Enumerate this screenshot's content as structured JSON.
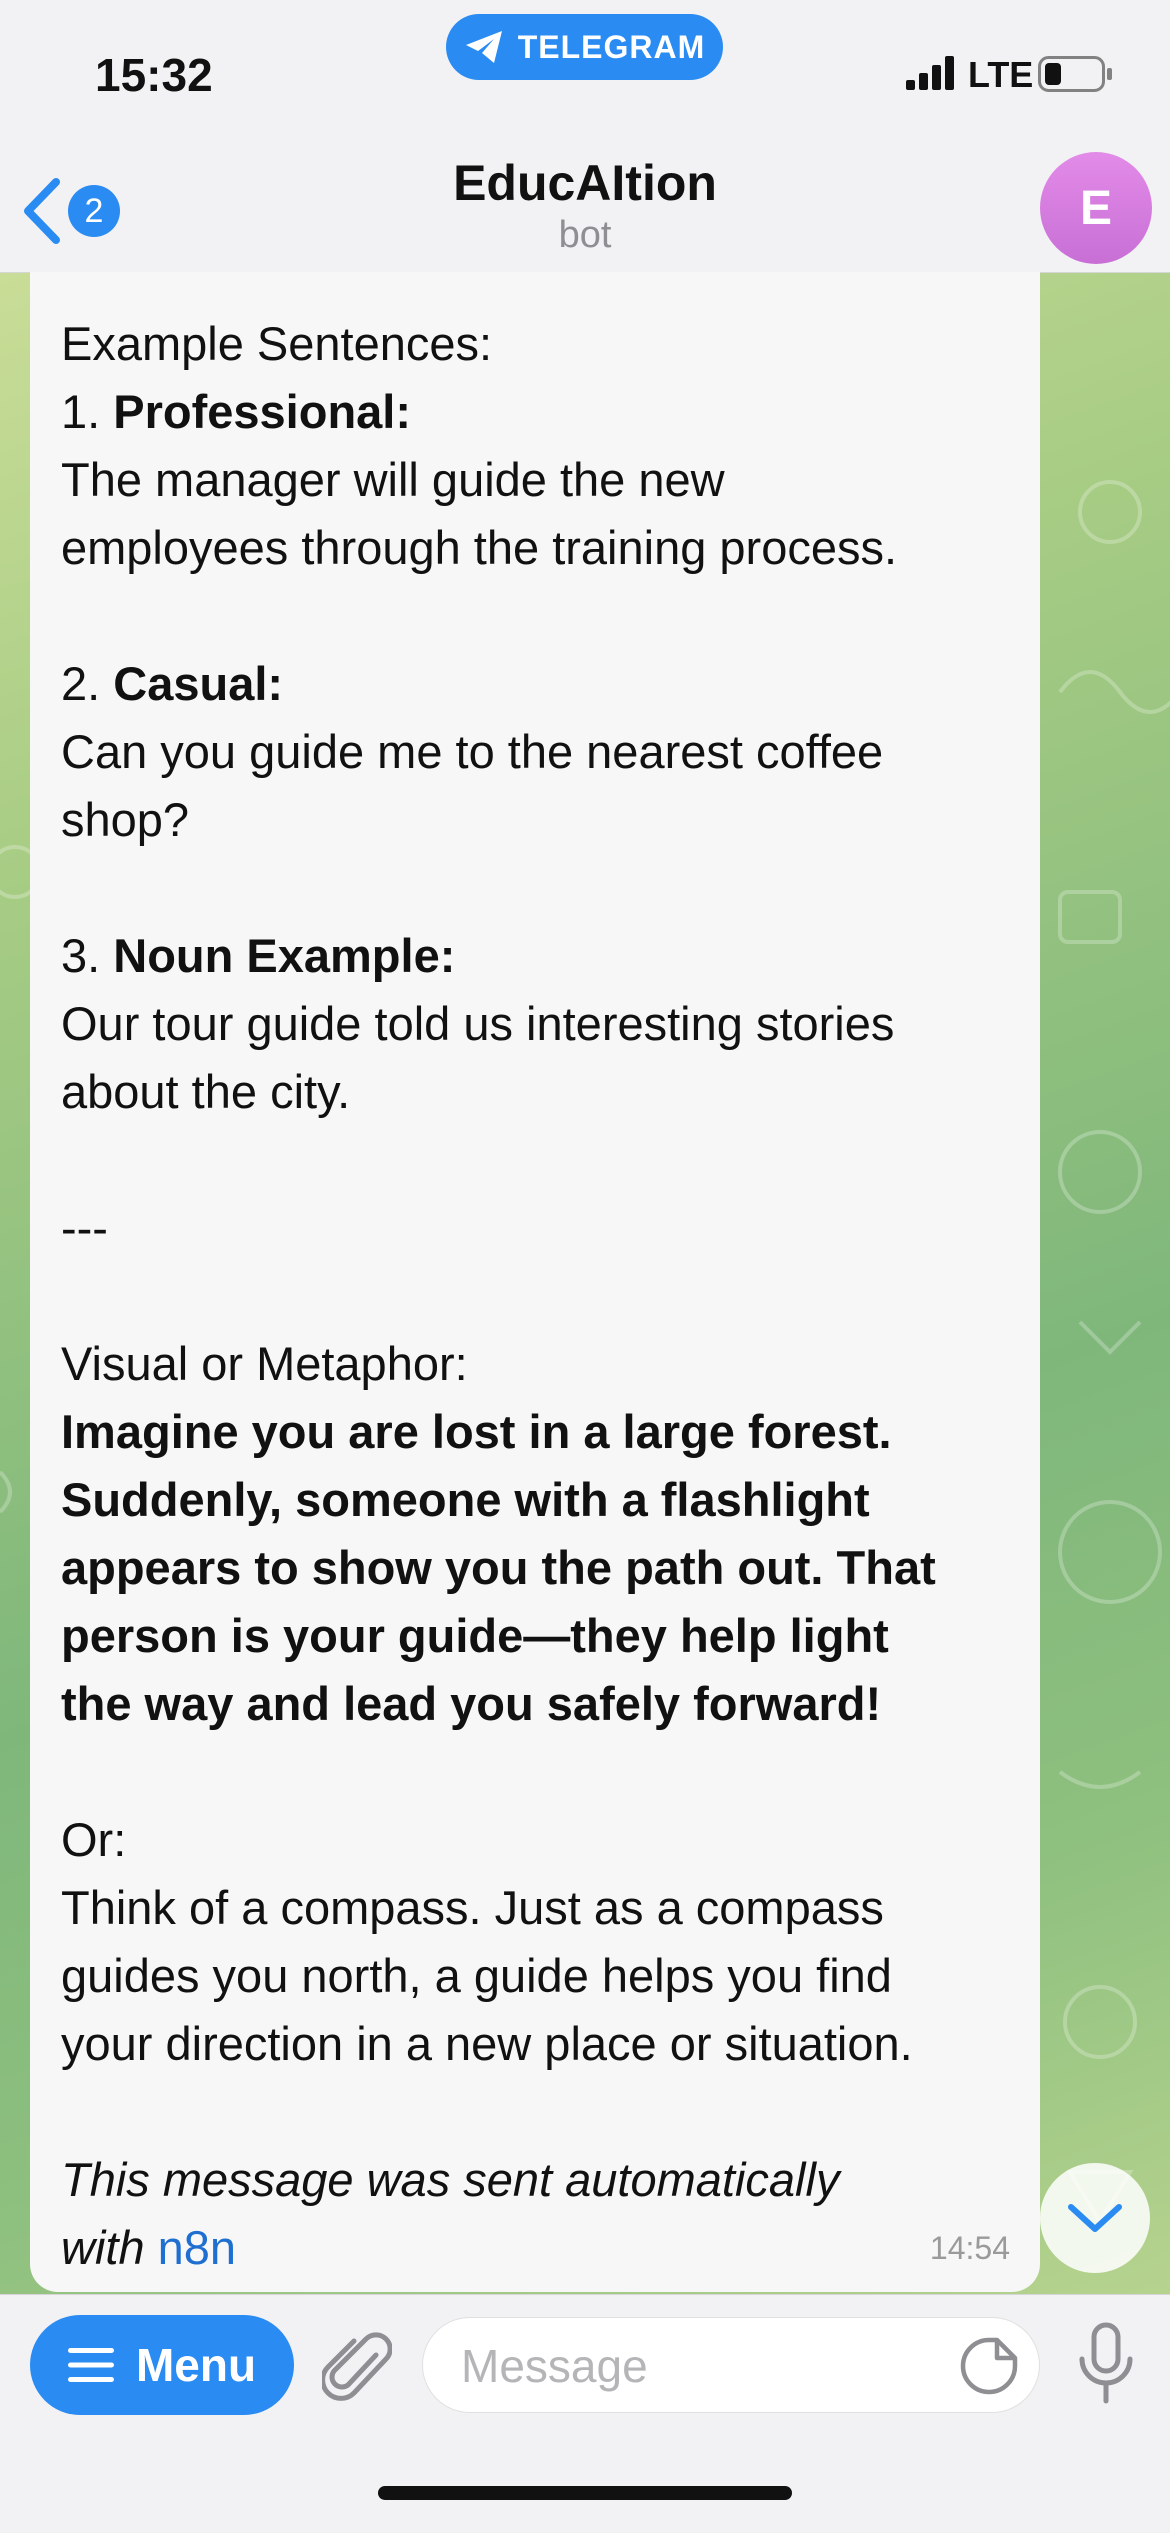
{
  "status_bar": {
    "time": "15:32",
    "carrier_pill": "TELEGRAM",
    "network": "LTE"
  },
  "header": {
    "back_badge": "2",
    "title": "EducAItion",
    "subtitle": "bot",
    "avatar_letter": "E"
  },
  "message": {
    "example_heading": "Example Sentences:",
    "ex1_num": "1. ",
    "ex1_label": "Professional:",
    "ex1_line1": "The manager will guide the new",
    "ex1_line2": "employees through the training process.",
    "ex2_num": "2. ",
    "ex2_label": "Casual:",
    "ex2_line1": "Can you guide me to the nearest coffee",
    "ex2_line2": "shop?",
    "ex3_num": "3. ",
    "ex3_label": "Noun Example:",
    "ex3_line1": "Our tour guide told us interesting stories",
    "ex3_line2": "about the city.",
    "separator": "---",
    "visual_heading": "Visual or Metaphor:",
    "visual_lines": [
      "Imagine you are lost in a large forest.",
      "Suddenly, someone with a flashlight",
      "appears to show you the path out. That",
      "person is your guide—they help light",
      "the way and lead you safely forward!"
    ],
    "or_label": "Or:",
    "or_lines": [
      "Think of a compass. Just as a compass",
      "guides you north, a guide helps you find",
      "your direction in a new place or situation."
    ],
    "footer_line1": "This message was sent automatically",
    "footer_line2_prefix": "with ",
    "footer_link": "n8n",
    "time": "14:54"
  },
  "input_bar": {
    "menu_label": "Menu",
    "placeholder": "Message"
  },
  "colors": {
    "accent": "#2a8bf2",
    "avatar": "#d27be0",
    "bubble": "#f7f7f7",
    "link": "#1f6fd0"
  }
}
